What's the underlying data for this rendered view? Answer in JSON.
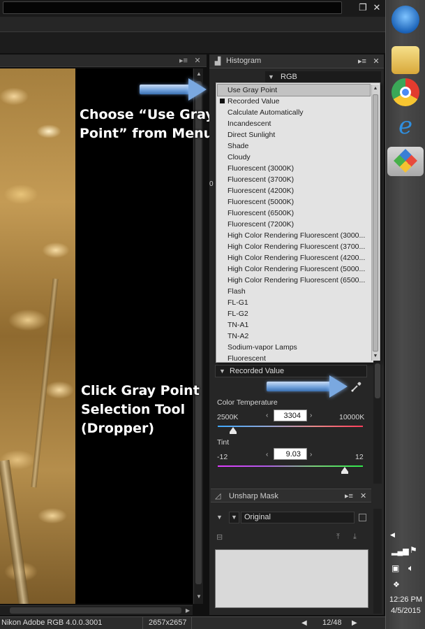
{
  "window": {
    "title": "",
    "restore_glyph": "❐",
    "close_glyph": "✕"
  },
  "viewer": {
    "header_menu_glyph": "▸≡",
    "header_close_glyph": "✕"
  },
  "annotations": {
    "choose_line1": "Choose “Use Gray",
    "choose_line2": "Point” from Menu",
    "click_line1": "Click Gray Point",
    "click_line2": "Selection Tool",
    "click_line3": "(Dropper)"
  },
  "histogram_panel": {
    "title": "Histogram",
    "channel": "RGB"
  },
  "wb_menu": {
    "items": [
      {
        "label": "Use Gray Point",
        "selected": true,
        "checked": false
      },
      {
        "label": "Recorded Value",
        "selected": false,
        "checked": true
      },
      {
        "label": "Calculate Automatically",
        "selected": false,
        "checked": false
      },
      {
        "label": "Incandescent",
        "selected": false,
        "checked": false
      },
      {
        "label": "Direct Sunlight",
        "selected": false,
        "checked": false
      },
      {
        "label": "Shade",
        "selected": false,
        "checked": false
      },
      {
        "label": "Cloudy",
        "selected": false,
        "checked": false
      },
      {
        "label": "Fluorescent (3000K)",
        "selected": false,
        "checked": false
      },
      {
        "label": "Fluorescent (3700K)",
        "selected": false,
        "checked": false
      },
      {
        "label": "Fluorescent (4200K)",
        "selected": false,
        "checked": false
      },
      {
        "label": "Fluorescent (5000K)",
        "selected": false,
        "checked": false
      },
      {
        "label": "Fluorescent (6500K)",
        "selected": false,
        "checked": false
      },
      {
        "label": "Fluorescent (7200K)",
        "selected": false,
        "checked": false
      },
      {
        "label": "High Color Rendering Fluorescent (3000...",
        "selected": false,
        "checked": false
      },
      {
        "label": "High Color Rendering Fluorescent (3700...",
        "selected": false,
        "checked": false
      },
      {
        "label": "High Color Rendering Fluorescent (4200...",
        "selected": false,
        "checked": false
      },
      {
        "label": "High Color Rendering Fluorescent (5000...",
        "selected": false,
        "checked": false
      },
      {
        "label": "High Color Rendering Fluorescent (6500...",
        "selected": false,
        "checked": false
      },
      {
        "label": "Flash",
        "selected": false,
        "checked": false
      },
      {
        "label": "FL-G1",
        "selected": false,
        "checked": false
      },
      {
        "label": "FL-G2",
        "selected": false,
        "checked": false
      },
      {
        "label": "TN-A1",
        "selected": false,
        "checked": false
      },
      {
        "label": "TN-A2",
        "selected": false,
        "checked": false
      },
      {
        "label": "Sodium-vapor Lamps",
        "selected": false,
        "checked": false
      },
      {
        "label": "Fluorescent",
        "selected": false,
        "checked": false
      }
    ]
  },
  "white_balance": {
    "current": "Recorded Value",
    "color_temperature_label": "Color Temperature",
    "temp_min": "2500K",
    "temp_max": "10000K",
    "temp_value": "3304",
    "temp_fraction": 0.107,
    "tint_label": "Tint",
    "tint_min": "-12",
    "tint_max": "12",
    "tint_value": "9.03",
    "tint_fraction": 0.876
  },
  "unsharp_panel": {
    "title": "Unsharp Mask",
    "preset": "Original"
  },
  "partial_labels": {
    "left_zero": "0"
  },
  "statusbar": {
    "profile": "Nikon Adobe RGB 4.0.0.3001",
    "dimensions": "2657x2657",
    "counter": "12/48"
  },
  "taskbar": {
    "time": "12:26 PM",
    "date": "4/5/2015"
  },
  "colors": {
    "arrow_blue": "#6d9ed9",
    "panel_bg": "#262626",
    "menu_bg": "#e3e3e3"
  }
}
